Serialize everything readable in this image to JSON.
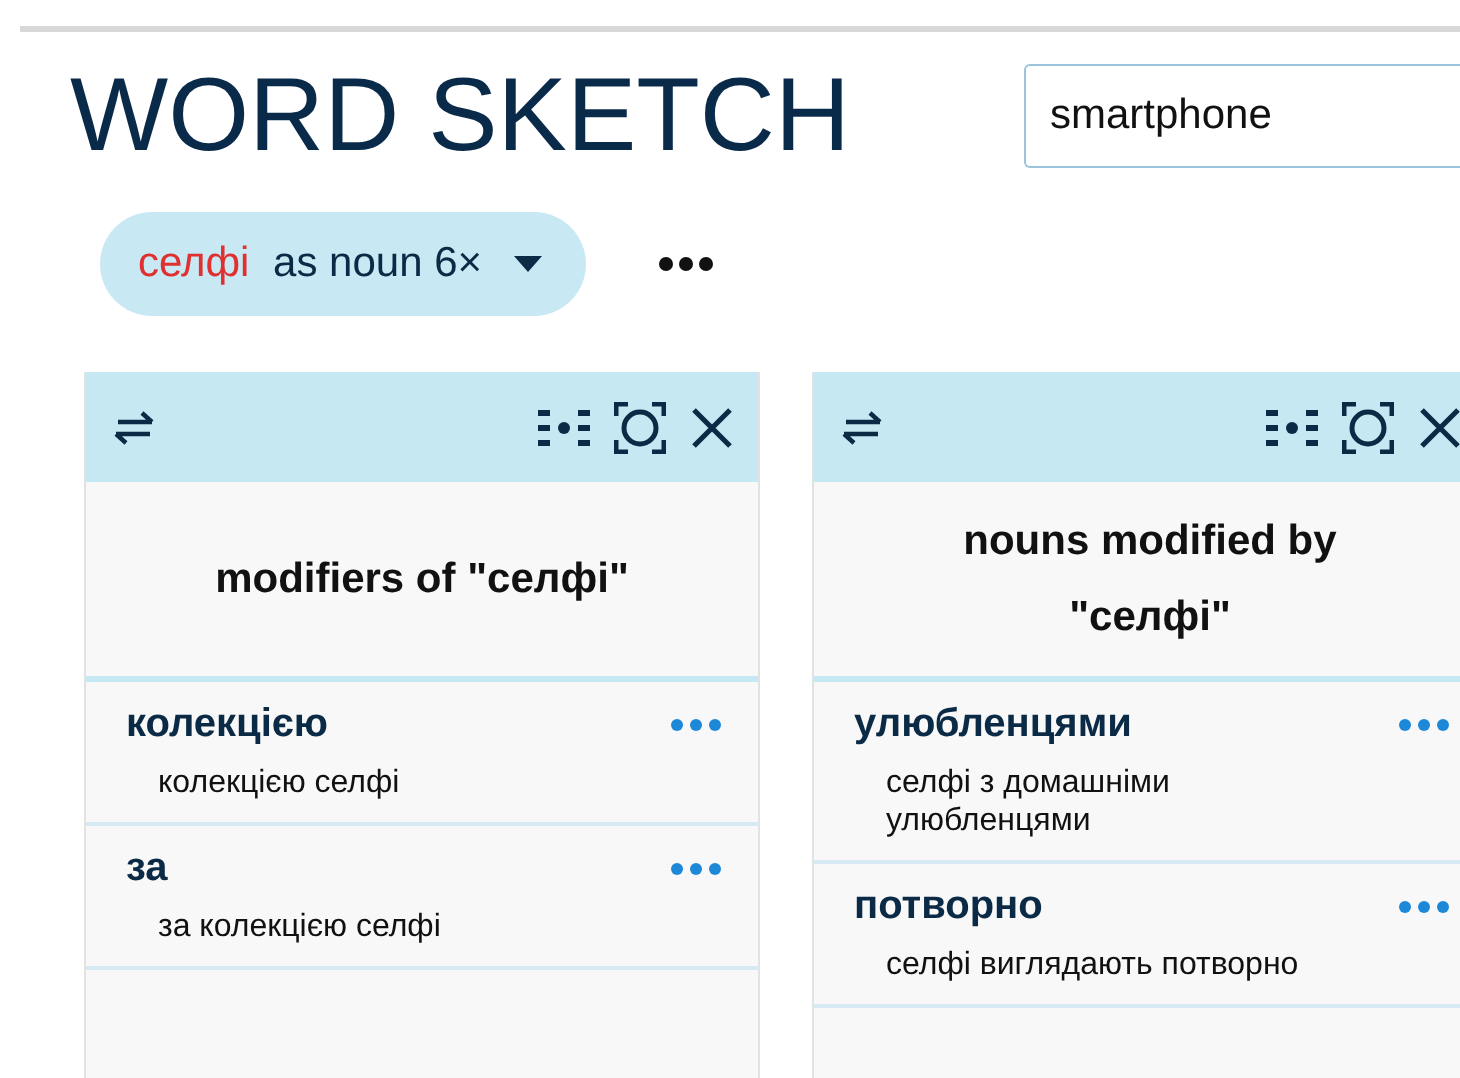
{
  "title": "WORD SKETCH",
  "search": {
    "value": "smartphone"
  },
  "lemma_chip": {
    "headword": "селфі",
    "label": "as noun 6×"
  },
  "panels": [
    {
      "title": "modifiers of \"селфі\"",
      "rows": [
        {
          "word": "колекцією",
          "example": "колекцією селфі"
        },
        {
          "word": "за",
          "example": "за колекцією селфі"
        }
      ]
    },
    {
      "title": "nouns modified by \"селфі\"",
      "rows": [
        {
          "word": "улюбленцями",
          "example": "селфі з домашніми улюбленцями"
        },
        {
          "word": "потворно",
          "example": "селфі виглядають потворно"
        }
      ]
    }
  ]
}
